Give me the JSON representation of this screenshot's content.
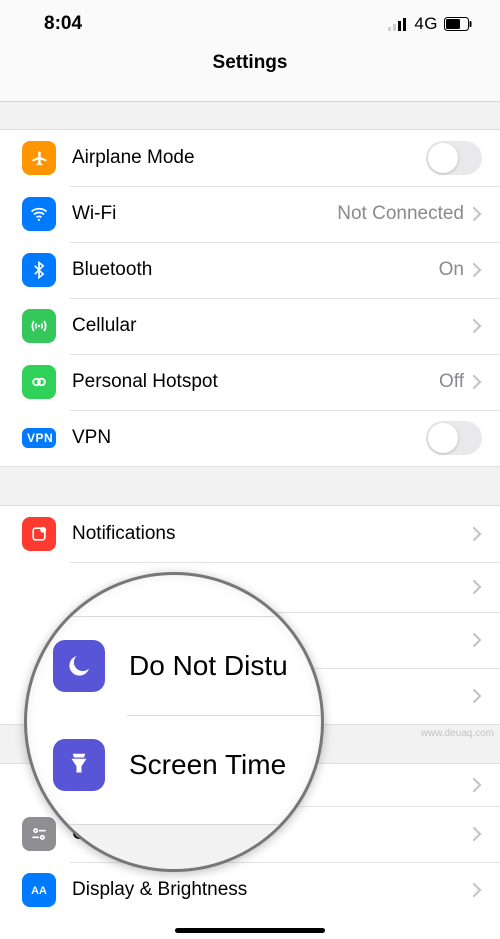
{
  "status": {
    "time": "8:04",
    "network": "4G"
  },
  "header": {
    "title": "Settings"
  },
  "groups": [
    {
      "items": [
        {
          "key": "airplane",
          "label": "Airplane Mode",
          "type": "toggle",
          "value": false,
          "icon": "airplane-icon",
          "color": "orange"
        },
        {
          "key": "wifi",
          "label": "Wi-Fi",
          "type": "link",
          "value": "Not Connected",
          "icon": "wifi-icon",
          "color": "blue"
        },
        {
          "key": "bluetooth",
          "label": "Bluetooth",
          "type": "link",
          "value": "On",
          "icon": "bluetooth-icon",
          "color": "blue"
        },
        {
          "key": "cellular",
          "label": "Cellular",
          "type": "link",
          "value": "",
          "icon": "cellular-icon",
          "color": "green"
        },
        {
          "key": "hotspot",
          "label": "Personal Hotspot",
          "type": "link",
          "value": "Off",
          "icon": "hotspot-icon",
          "color": "green"
        },
        {
          "key": "vpn",
          "label": "VPN",
          "type": "toggle",
          "value": false,
          "icon": "vpn-icon",
          "color": "blue",
          "badge": "VPN"
        }
      ]
    },
    {
      "items": [
        {
          "key": "notifications",
          "label": "Notifications",
          "type": "link",
          "icon": "notifications-icon",
          "color": "red"
        },
        {
          "key": "sounds",
          "label": "",
          "type": "link",
          "icon": "sounds-icon",
          "color": "red"
        },
        {
          "key": "dnd",
          "label": "",
          "type": "link",
          "icon": "dnd-icon",
          "color": "purple"
        },
        {
          "key": "screentime",
          "label": "",
          "type": "link",
          "icon": "screentime-icon",
          "color": "purple"
        }
      ]
    },
    {
      "items": [
        {
          "key": "general",
          "label": "",
          "type": "link",
          "icon": "general-icon",
          "color": "gray"
        },
        {
          "key": "controlcenter",
          "label": "Control Center",
          "type": "link",
          "icon": "controlcenter-icon",
          "color": "gray"
        },
        {
          "key": "display",
          "label": "Display & Brightness",
          "type": "link",
          "icon": "display-icon",
          "color": "blue"
        }
      ]
    }
  ],
  "magnifier": {
    "items": [
      {
        "label": "Do Not Distu",
        "icon": "dnd-icon"
      },
      {
        "label": "Screen Time",
        "icon": "screentime-icon"
      }
    ]
  },
  "watermark": "www.deuaq.com"
}
